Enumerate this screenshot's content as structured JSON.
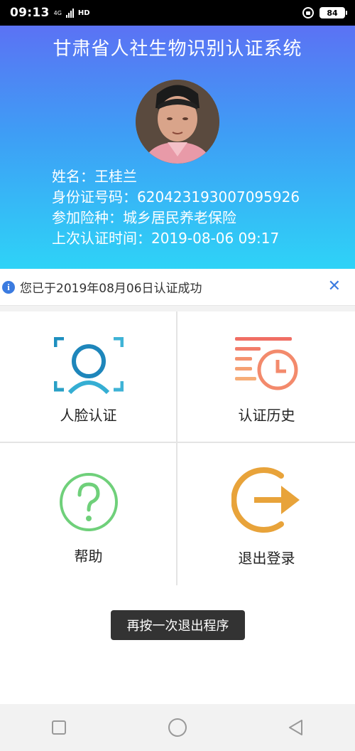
{
  "status_bar": {
    "time": "09:13",
    "network_top": "4G",
    "network_hd": "HD",
    "battery": "84"
  },
  "header": {
    "title": "甘肃省人社生物识别认证系统",
    "name": "姓名：王桂兰",
    "id_number": "身份证号码：620423193007095926",
    "insurance": "参加险种：城乡居民养老保险",
    "last_auth": "上次认证时间：2019-08-06  09:17"
  },
  "notice": {
    "icon": "info-icon",
    "text": "您已于2019年08月06日认证成功",
    "close": "close-icon"
  },
  "menu": {
    "face_auth": "人脸认证",
    "history": "认证历史",
    "help": "帮助",
    "logout": "退出登录"
  },
  "toast": "再按一次退出程序",
  "nav": {
    "recent": "square-icon",
    "home": "circle-icon",
    "back": "triangle-icon"
  },
  "colors": {
    "header_top": "#5b72f4",
    "header_bottom": "#2ed3f7",
    "face_icon": "#1e8fbf",
    "history_icon": "#f08a6c",
    "help_icon": "#6fd07a",
    "logout_icon": "#e8a33a"
  }
}
